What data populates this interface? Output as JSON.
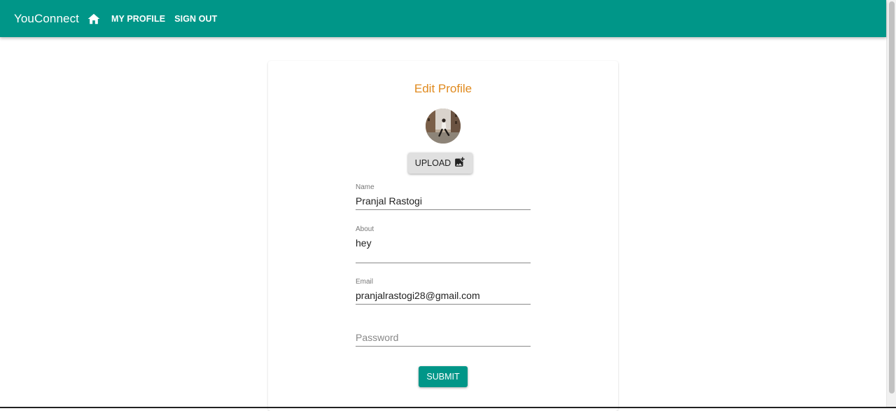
{
  "appbar": {
    "brand": "YouConnect",
    "home_icon": "home-icon",
    "nav": [
      "MY PROFILE",
      "SIGN OUT"
    ],
    "color": "#009688"
  },
  "form": {
    "title": "Edit Profile",
    "title_color": "#e08a1e",
    "upload_label": "UPLOAD",
    "upload_icon": "add-photo-icon",
    "fields": {
      "name": {
        "label": "Name",
        "value": "Pranjal Rastogi"
      },
      "about": {
        "label": "About",
        "value": "hey"
      },
      "email": {
        "label": "Email",
        "value": "pranjalrastogi28@gmail.com"
      },
      "password": {
        "placeholder": "Password",
        "value": ""
      }
    },
    "submit_label": "SUBMIT"
  }
}
